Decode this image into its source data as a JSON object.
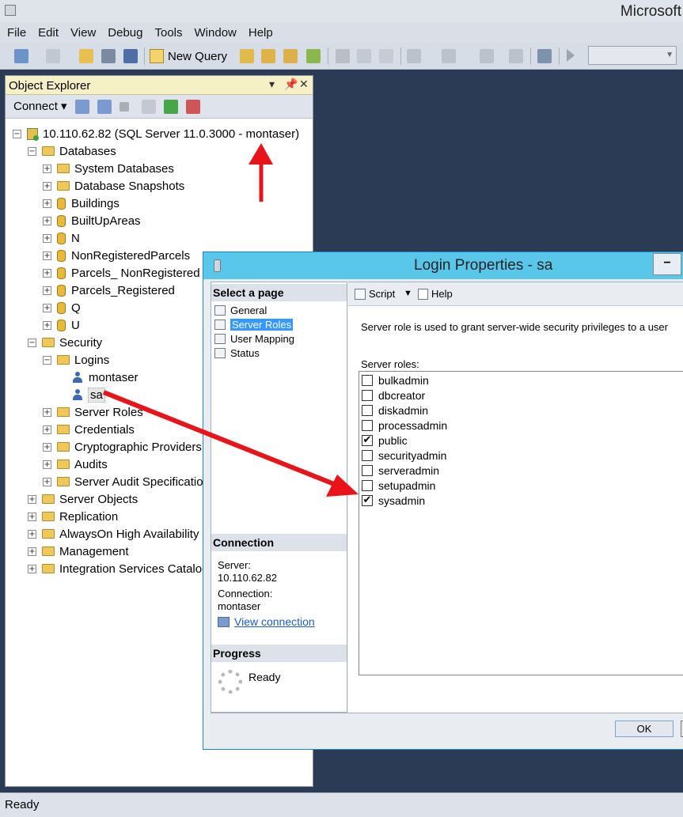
{
  "window": {
    "title": "Microsoft"
  },
  "menu": [
    "File",
    "Edit",
    "View",
    "Debug",
    "Tools",
    "Window",
    "Help"
  ],
  "toolbar": {
    "new_query": "New Query"
  },
  "object_explorer": {
    "title": "Object Explorer",
    "connect": "Connect ▾",
    "server": "10.110.62.82 (SQL Server 11.0.3000 - montaser)",
    "databases": "Databases",
    "db_items": [
      "System Databases",
      "Database Snapshots",
      "Buildings",
      "BuiltUpAreas",
      "N",
      "NonRegisteredParcels",
      "Parcels_ NonRegistered",
      "Parcels_Registered",
      "Q",
      "U"
    ],
    "security": "Security",
    "logins": "Logins",
    "login_items": [
      "montaser",
      "sa"
    ],
    "security_items": [
      "Server Roles",
      "Credentials",
      "Cryptographic Providers",
      "Audits",
      "Server Audit Specification"
    ],
    "top_items": [
      "Server Objects",
      "Replication",
      "AlwaysOn High Availability",
      "Management",
      "Integration Services Catalog"
    ]
  },
  "status": "Ready",
  "dialog": {
    "title": "Login Properties - sa",
    "select_page": "Select a page",
    "pages": [
      "General",
      "Server Roles",
      "User Mapping",
      "Status"
    ],
    "active_page": "Server Roles",
    "connection_head": "Connection",
    "server_label": "Server:",
    "server_value": "10.110.62.82",
    "connection_label": "Connection:",
    "connection_value": "montaser",
    "view_connection": "View connection",
    "progress_head": "Progress",
    "progress_text": "Ready",
    "script": "Script",
    "help": "Help",
    "description": "Server role is used to grant server-wide security privileges to a user",
    "roles_label": "Server roles:",
    "roles": [
      {
        "name": "bulkadmin",
        "checked": false
      },
      {
        "name": "dbcreator",
        "checked": false
      },
      {
        "name": "diskadmin",
        "checked": false
      },
      {
        "name": "processadmin",
        "checked": false
      },
      {
        "name": "public",
        "checked": true
      },
      {
        "name": "securityadmin",
        "checked": false
      },
      {
        "name": "serveradmin",
        "checked": false
      },
      {
        "name": "setupadmin",
        "checked": false
      },
      {
        "name": "sysadmin",
        "checked": true
      }
    ],
    "ok": "OK"
  },
  "colors": {
    "annotation_arrow": "#e8141a",
    "dialog_title": "#59c7ea",
    "background": "#2b3a55"
  }
}
